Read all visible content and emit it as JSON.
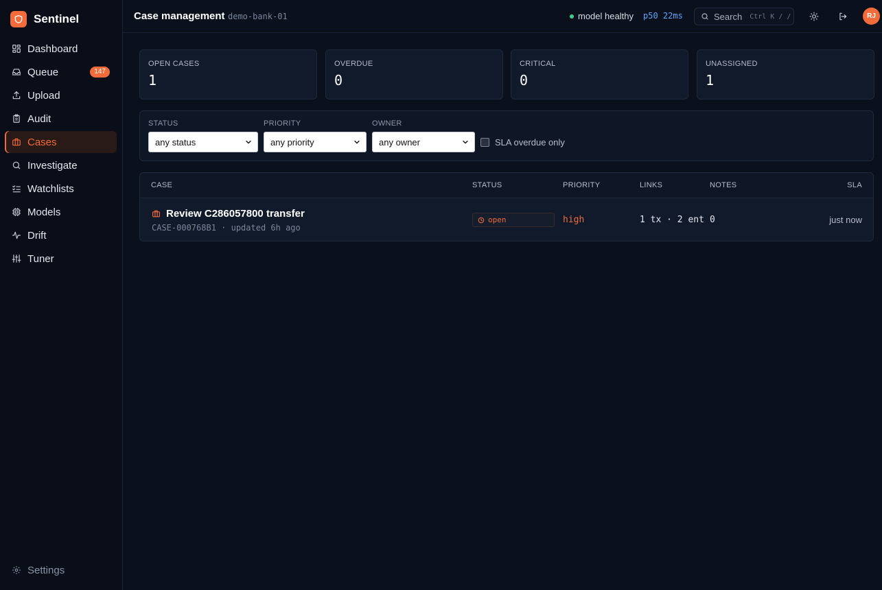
{
  "app": {
    "name": "Sentinel"
  },
  "sidebar": {
    "items": [
      {
        "label": "Dashboard",
        "icon": "dashboard-icon"
      },
      {
        "label": "Queue",
        "icon": "inbox-icon",
        "badge": "147"
      },
      {
        "label": "Upload",
        "icon": "upload-icon"
      },
      {
        "label": "Audit",
        "icon": "clipboard-icon"
      },
      {
        "label": "Cases",
        "icon": "briefcase-icon",
        "active": true
      },
      {
        "label": "Investigate",
        "icon": "search-icon"
      },
      {
        "label": "Watchlists",
        "icon": "checklist-icon"
      },
      {
        "label": "Models",
        "icon": "chip-icon"
      },
      {
        "label": "Drift",
        "icon": "activity-icon"
      },
      {
        "label": "Tuner",
        "icon": "sliders-icon"
      }
    ],
    "settings_label": "Settings"
  },
  "header": {
    "title": "Case management",
    "tenant": "demo-bank-01",
    "health": "model healthy",
    "latency": "p50 22ms",
    "search_label": "Search",
    "search_shortcut": "Ctrl K / /",
    "avatar_initials": "RJ"
  },
  "kpis": [
    {
      "label": "OPEN CASES",
      "value": "1"
    },
    {
      "label": "OVERDUE",
      "value": "0"
    },
    {
      "label": "CRITICAL",
      "value": "0"
    },
    {
      "label": "UNASSIGNED",
      "value": "1"
    }
  ],
  "filters": {
    "status": {
      "label": "STATUS",
      "value": "any status"
    },
    "priority": {
      "label": "PRIORITY",
      "value": "any priority"
    },
    "owner": {
      "label": "OWNER",
      "value": "any owner"
    },
    "sla_only": "SLA overdue only"
  },
  "table": {
    "columns": [
      "CASE",
      "STATUS",
      "PRIORITY",
      "LINKS",
      "NOTES",
      "SLA"
    ],
    "rows": [
      {
        "title": "Review C286057800 transfer",
        "sub": "CASE-000768B1 · updated 6h ago",
        "status": "open",
        "priority": "high",
        "links": "1 tx · 2 ent",
        "notes": "0",
        "sla": "just now"
      }
    ]
  },
  "colors": {
    "accent": "#f26b3a",
    "background": "#0a101c",
    "healthy": "#3ecf8e",
    "latency": "#5aa7ff"
  }
}
